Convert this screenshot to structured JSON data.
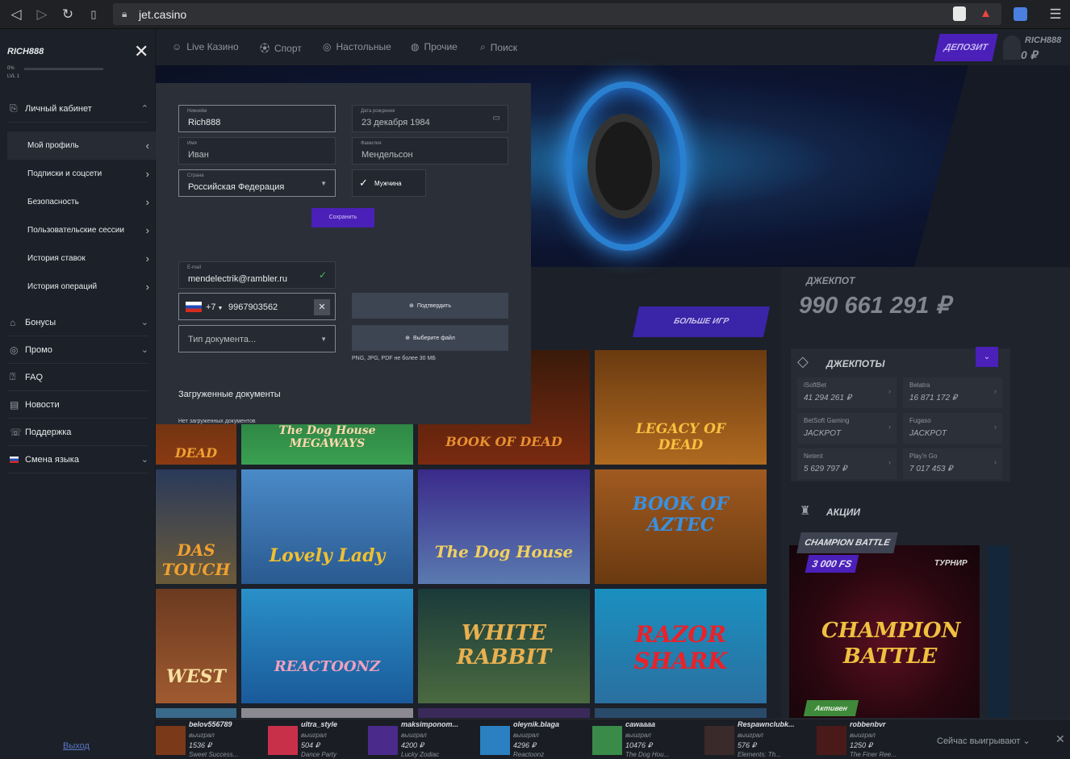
{
  "browser": {
    "url": "jet.casino"
  },
  "user": {
    "name": "RICH888",
    "progress": "0%",
    "level": "LVL 1",
    "balance": "0 ₽"
  },
  "nav": {
    "live": "Live Казино",
    "sport": "Спорт",
    "table": "Настольные",
    "other": "Прочие",
    "search": "Поиск",
    "deposit": "ДЕПОЗИТ"
  },
  "sidebar": {
    "cabinet": "Личный кабинет",
    "subs": [
      {
        "label": "Мой профиль"
      },
      {
        "label": "Подписки и соцсети"
      },
      {
        "label": "Безопасность"
      },
      {
        "label": "Пользовательские сессии"
      },
      {
        "label": "История ставок"
      },
      {
        "label": "История операций"
      }
    ],
    "items": [
      {
        "label": "Бонусы"
      },
      {
        "label": "Промо"
      },
      {
        "label": "FAQ"
      },
      {
        "label": "Новости"
      },
      {
        "label": "Поддержка"
      },
      {
        "label": "Смена языка"
      }
    ],
    "logout": "Выход"
  },
  "profile": {
    "nick_label": "Никнейм",
    "nick": "Rich888",
    "dob_label": "Дата рождения",
    "dob": "23 декабря 1984",
    "name_label": "Имя",
    "name": "Иван",
    "surname_label": "Фамилия",
    "surname": "Мендельсон",
    "country_label": "Страна",
    "country": "Российская Федерация",
    "gender": "Мужчина",
    "save": "Сохранить",
    "email_label": "E-mail",
    "email": "mendelectrik@rambler.ru",
    "phone_code": "+7",
    "phone": "9967903562",
    "confirm": "Подтвердить",
    "doc_type": "Тип документа...",
    "choose_file": "Выберите файл",
    "file_note": "PNG, JPG, PDF не более 30 МБ",
    "docs_title": "Загруженные документы",
    "docs_empty": "Нет загруженных документов"
  },
  "games": {
    "more": "БОЛЬШЕ ИГР",
    "tiles": [
      {
        "title": "DEAD"
      },
      {
        "title": "The Dog House MEGAWAYS"
      },
      {
        "title": "BOOK OF DEAD"
      },
      {
        "title": "LEGACY OF DEAD"
      },
      {
        "title": "DAS TOUCH"
      },
      {
        "title": "Lovely Lady"
      },
      {
        "title": "The Dog House"
      },
      {
        "title": "BOOK OF AZTEC"
      },
      {
        "title": "WEST"
      },
      {
        "title": "REACTOONZ"
      },
      {
        "title": "WHITE RABBIT"
      },
      {
        "title": "RAZOR SHARK"
      }
    ]
  },
  "jackpot": {
    "title": "ДЖЕКПОТ",
    "amount": "990 661 291 ₽",
    "list_title": "ДЖЕКПОТЫ",
    "cells": [
      {
        "name": "iSoftBet",
        "value": "41 294 261 ₽"
      },
      {
        "name": "Belatra",
        "value": "16 871 172 ₽"
      },
      {
        "name": "BetSoft Gaming",
        "value": "JACKPOT"
      },
      {
        "name": "Fugaso",
        "value": "JACKPOT"
      },
      {
        "name": "Netent",
        "value": "5 629 797 ₽"
      },
      {
        "name": "Play'n Go",
        "value": "7 017 453 ₽"
      }
    ]
  },
  "promo": {
    "section": "АКЦИИ",
    "name": "CHAMPION BATTLE",
    "fs": "3 000 FS",
    "type": "ТУРНИР",
    "banner": "CHAMPION BATTLE",
    "status": "Активен"
  },
  "winners": {
    "label": "Сейчас выигрывают",
    "list": [
      {
        "user": "belov556789",
        "won": "выиграл",
        "amount": "1536 ₽",
        "game": "Sweet Success..."
      },
      {
        "user": "ultra_style",
        "won": "выиграл",
        "amount": "504 ₽",
        "game": "Dance Party"
      },
      {
        "user": "maksimponom...",
        "won": "выиграл",
        "amount": "4200 ₽",
        "game": "Lucky Zodiac"
      },
      {
        "user": "oleynik.blaga",
        "won": "выиграл",
        "amount": "4296 ₽",
        "game": "Reactoonz"
      },
      {
        "user": "cawaaaa",
        "won": "выиграл",
        "amount": "10476 ₽",
        "game": "The Dog Hou..."
      },
      {
        "user": "Respawnclubk...",
        "won": "выиграл",
        "amount": "576 ₽",
        "game": "Elements: Th..."
      },
      {
        "user": "robbenbvr",
        "won": "выиграл",
        "amount": "1250 ₽",
        "game": "The Finer Ree..."
      }
    ]
  }
}
